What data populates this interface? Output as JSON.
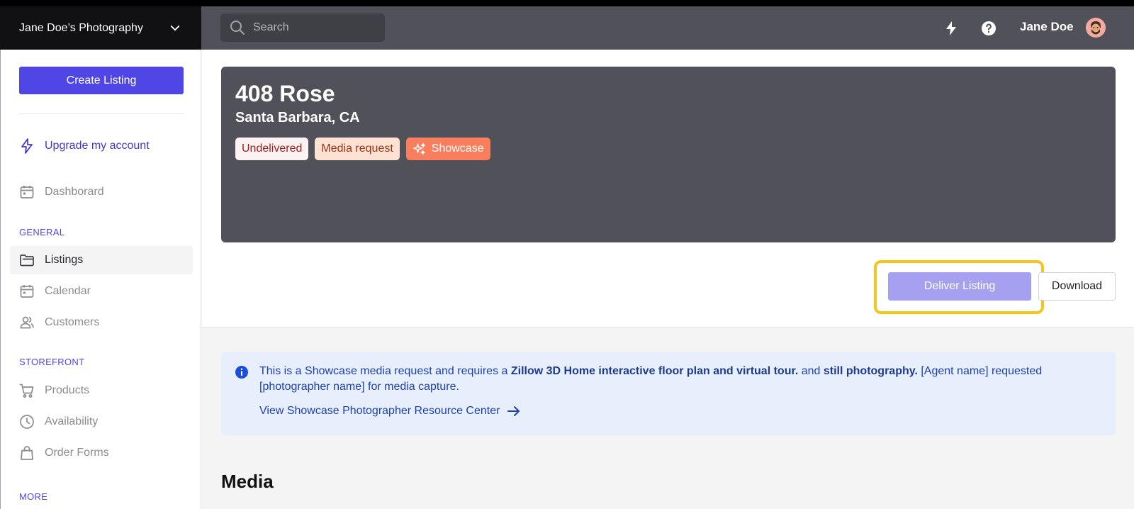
{
  "header": {
    "brand": "Jane Doe’s Photography",
    "search_placeholder": "Search",
    "user_name": "Jane Doe"
  },
  "sidebar": {
    "create_label": "Create Listing",
    "upgrade_label": "Upgrade my account",
    "dashboard_label": "Dashborard",
    "sections": {
      "general": "GENERAL",
      "storefront": "STOREFRONT",
      "more": "MORE"
    },
    "general_items": [
      "Listings",
      "Calendar",
      "Customers"
    ],
    "storefront_items": [
      "Products",
      "Availability",
      "Order Forms"
    ],
    "active_item": "Listings"
  },
  "listing": {
    "title": "408 Rose",
    "location": "Santa Barbara, CA",
    "badges": {
      "undelivered": "Undelivered",
      "media_request": "Media request",
      "showcase": "Showcase"
    },
    "deliver_label": "Deliver Listing",
    "download_label": "Download"
  },
  "info": {
    "part1": "This is a Showcase media request and requires a ",
    "bold1": "Zillow 3D Home interactive floor plan and virtual tour.",
    "part2": " and ",
    "bold2": "still photography.",
    "part3": "  [Agent name] requested [photographer name] for media capture.",
    "link_label": "View Showcase Photographer Resource Center"
  },
  "media": {
    "title": "Media"
  },
  "colors": {
    "accent": "#4f46e5",
    "showcase": "#f97e5d",
    "highlight": "#f5c518"
  }
}
